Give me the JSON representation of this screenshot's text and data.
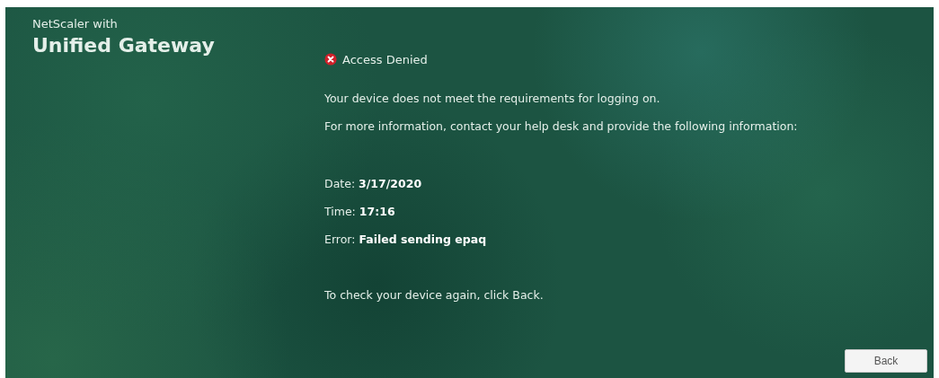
{
  "brand": {
    "subtitle": "NetScaler with",
    "title": "Unified Gateway"
  },
  "message": {
    "title": "Access Denied",
    "paragraphs": [
      "Your device does not meet the requirements for logging on.",
      "For more information, contact your help desk and provide the following information:"
    ]
  },
  "details": [
    {
      "label": "Date:",
      "value": "3/17/2020"
    },
    {
      "label": "Time:",
      "value": "17:16"
    },
    {
      "label": "Error:",
      "value": "Failed sending epaq"
    }
  ],
  "instruction": "To check your device again, click Back.",
  "buttons": [
    {
      "label": "Back"
    }
  ]
}
